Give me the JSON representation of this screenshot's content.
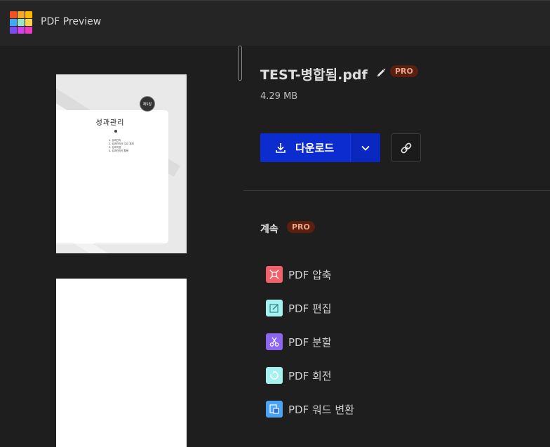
{
  "app": {
    "title": "PDF Preview",
    "logo_colors": [
      "#f25022",
      "#f9a825",
      "#ffb900",
      "#3fa9f5",
      "#9be8c5",
      "#ffd34e",
      "#7a4cf0",
      "#d541e8",
      "#e83dbf"
    ]
  },
  "preview": {
    "page1": {
      "chapter_badge": "제5장",
      "heading": "성과관리",
      "lines": [
        "1. 성과관리",
        "2. 성과관리의 주요 체계",
        "3. 성과지표",
        "4. 성과관리의 활용"
      ]
    }
  },
  "file": {
    "name": "TEST-병합됨.pdf",
    "pro_badge": "PRO",
    "size": "4.29 MB"
  },
  "actions": {
    "download_label": "다운로드",
    "download_color": "#0d2cd0"
  },
  "continue_section": {
    "label": "계속",
    "pro_badge": "PRO",
    "tools": [
      {
        "label": "PDF 압축",
        "icon": "compress-icon",
        "color": "#f2606a"
      },
      {
        "label": "PDF 편집",
        "icon": "edit-icon",
        "color": "#a6f1ef"
      },
      {
        "label": "PDF 분할",
        "icon": "scissors-icon",
        "color": "#8c66f0"
      },
      {
        "label": "PDF 회전",
        "icon": "rotate-icon",
        "color": "#a6f1ef"
      },
      {
        "label": "PDF 워드 변환",
        "icon": "word-convert-icon",
        "color": "#4aa3f5"
      }
    ]
  }
}
